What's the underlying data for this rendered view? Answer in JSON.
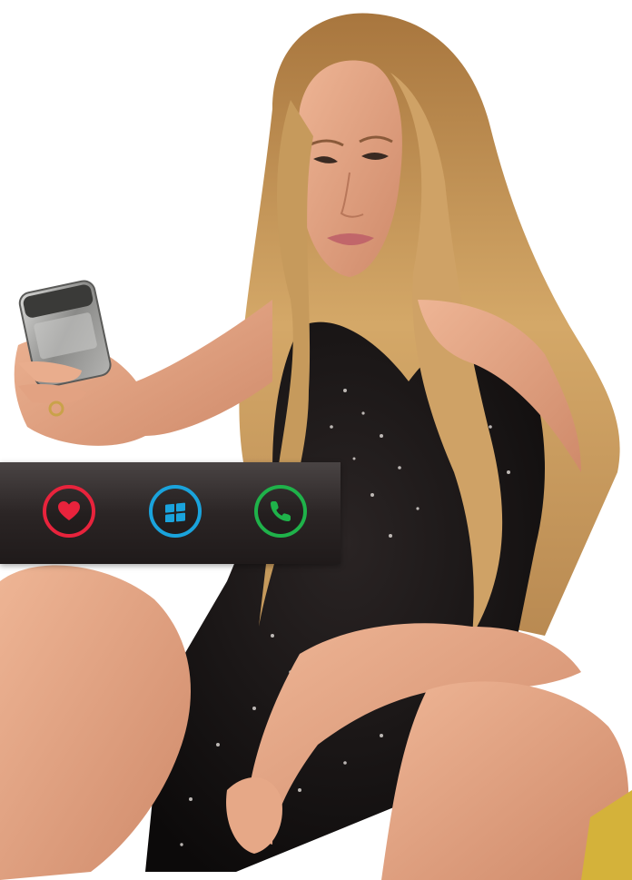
{
  "photo": {
    "subject": "woman-with-phone",
    "colors": {
      "hair": "#c89a5a",
      "hair_dark": "#8a5a2a",
      "skin": "#e6a887",
      "skin_shadow": "#c98363",
      "dress": "#161313",
      "phone": "#9a9a98"
    }
  },
  "button_bar": {
    "background": "#2b2525",
    "buttons": [
      {
        "id": "favorite",
        "icon": "heart-icon",
        "color": "#e8233c"
      },
      {
        "id": "start",
        "icon": "windows-logo-icon",
        "color": "#1aa3dc"
      },
      {
        "id": "call",
        "icon": "phone-icon",
        "color": "#1fb24a"
      }
    ]
  }
}
